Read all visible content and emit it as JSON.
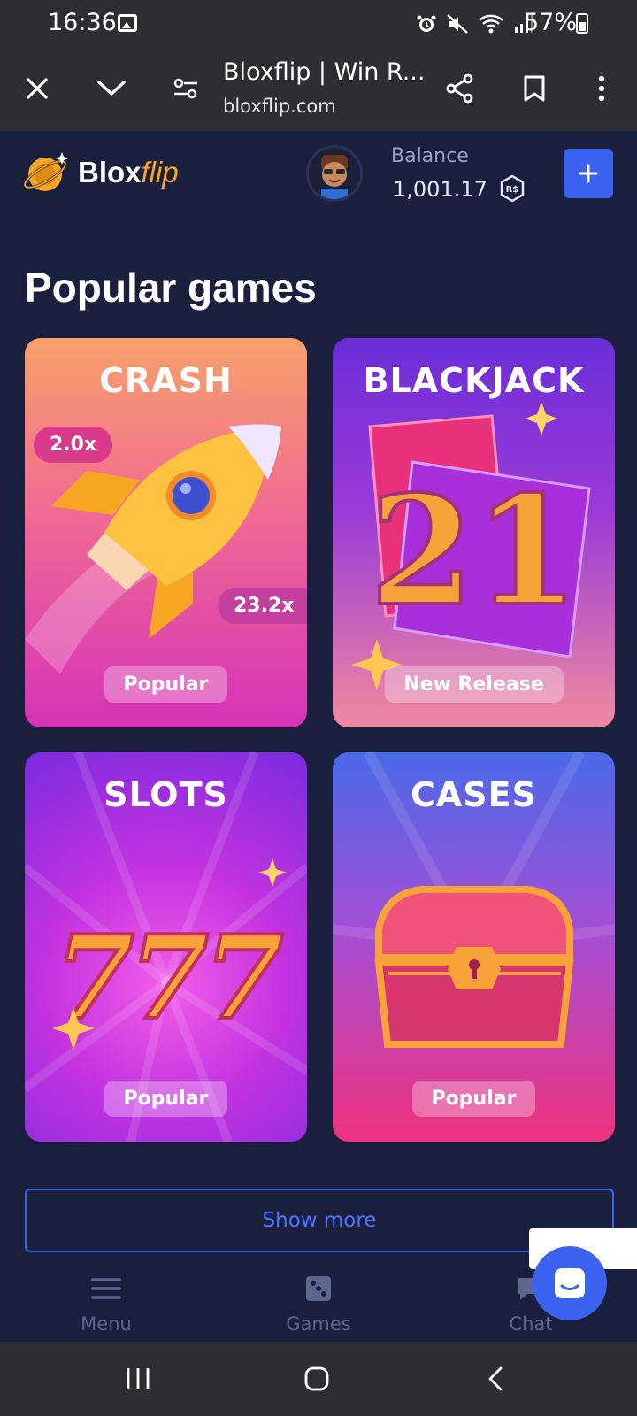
{
  "status_bar": {
    "time": "16:36",
    "battery_pct": "57%",
    "icons": [
      "image-icon",
      "alarm-icon",
      "mute-icon",
      "wifi-icon",
      "signal-icon",
      "battery-icon"
    ]
  },
  "browser": {
    "title": "Bloxflip | Win R...",
    "url": "bloxflip.com",
    "icons": [
      "close-icon",
      "chevron-down-icon",
      "site-settings-icon",
      "share-icon",
      "bookmark-icon",
      "more-vert-icon"
    ]
  },
  "header": {
    "logo_text_a": "Blox",
    "logo_text_b": "flip",
    "balance_label": "Balance",
    "balance_value": "1,001.17",
    "currency_icon": "robux-icon",
    "add_button_icon": "plus-icon"
  },
  "main": {
    "section_title": "Popular games",
    "games": [
      {
        "title": "CRASH",
        "badge": "Popular",
        "multipliers": [
          "2.0x",
          "23.2x"
        ]
      },
      {
        "title": "BLACKJACK",
        "badge": "New Release",
        "art_text": "21"
      },
      {
        "title": "SLOTS",
        "badge": "Popular",
        "art_text": "777"
      },
      {
        "title": "CASES",
        "badge": "Popular"
      }
    ],
    "show_more": "Show more"
  },
  "bottom_nav": {
    "items": [
      {
        "label": "Menu",
        "icon": "hamburger-icon"
      },
      {
        "label": "Games",
        "icon": "dice-icon"
      },
      {
        "label": "Chat",
        "icon": "chat-icon"
      }
    ]
  },
  "colors": {
    "background": "#1a1f3d",
    "accent": "#3c63f0",
    "logo_accent": "#f5a623",
    "nav_muted": "#5e6690"
  }
}
